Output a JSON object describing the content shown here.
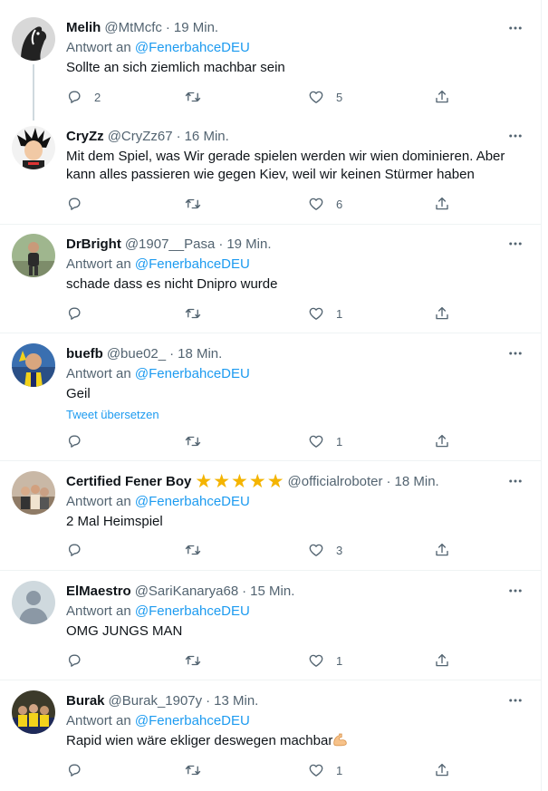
{
  "colors": {
    "text": "#0f1419",
    "secondary": "#536471",
    "link": "#1d9bf0",
    "star": "#f4b400",
    "border": "#eff3f4"
  },
  "tweets": [
    {
      "name": "Melih",
      "handle": "@MtMcfc",
      "time": "19 Min.",
      "reply_prefix": "Antwort an",
      "reply_to": "@FenerbahceDEU",
      "text": "Sollte an sich ziemlich machbar sein",
      "replies": "2",
      "retweets": "",
      "likes": "5",
      "avatar_icon": "black-white-horse-avatar"
    },
    {
      "name": "CryZz",
      "handle": "@CryZz67",
      "time": "16 Min.",
      "text": "Mit dem Spiel, was Wir gerade spielen werden wir wien dominieren. Aber kann alles passieren wie gegen Kiev, weil wir keinen Stürmer haben",
      "replies": "",
      "retweets": "",
      "likes": "6",
      "avatar_icon": "goku-avatar"
    },
    {
      "name": "DrBright",
      "handle": "@1907__Pasa",
      "time": "19 Min.",
      "reply_prefix": "Antwort an",
      "reply_to": "@FenerbahceDEU",
      "text": "schade dass es nicht Dnipro wurde",
      "replies": "",
      "retweets": "",
      "likes": "1",
      "avatar_icon": "person-photo-avatar"
    },
    {
      "name": "buefb",
      "handle": "@bue02_",
      "time": "18 Min.",
      "reply_prefix": "Antwort an",
      "reply_to": "@FenerbahceDEU",
      "text": "Geil",
      "translate": "Tweet übersetzen",
      "replies": "",
      "retweets": "",
      "likes": "1",
      "avatar_icon": "fan-photo-avatar"
    },
    {
      "name": "Certified Fener Boy",
      "stars": [
        "★",
        "★",
        "★",
        "★",
        "★"
      ],
      "handle": "@officialroboter",
      "time": "18 Min.",
      "reply_prefix": "Antwort an",
      "reply_to": "@FenerbahceDEU",
      "text": "2 Mal Heimspiel",
      "replies": "",
      "retweets": "",
      "likes": "3",
      "avatar_icon": "group-photo-avatar"
    },
    {
      "name": "ElMaestro",
      "handle": "@SariKanarya68",
      "time": "15 Min.",
      "reply_prefix": "Antwort an",
      "reply_to": "@FenerbahceDEU",
      "text": "OMG JUNGS MAN",
      "replies": "",
      "retweets": "",
      "likes": "1",
      "avatar_icon": "default-profile-avatar"
    },
    {
      "name": "Burak",
      "handle": "@Burak_1907y",
      "time": "13 Min.",
      "reply_prefix": "Antwort an",
      "reply_to": "@FenerbahceDEU",
      "text": "Rapid wien wäre ekliger deswegen machbar",
      "emoji": "flexed-biceps-emoji",
      "replies": "",
      "retweets": "",
      "likes": "1",
      "avatar_icon": "team-photo-avatar"
    }
  ]
}
